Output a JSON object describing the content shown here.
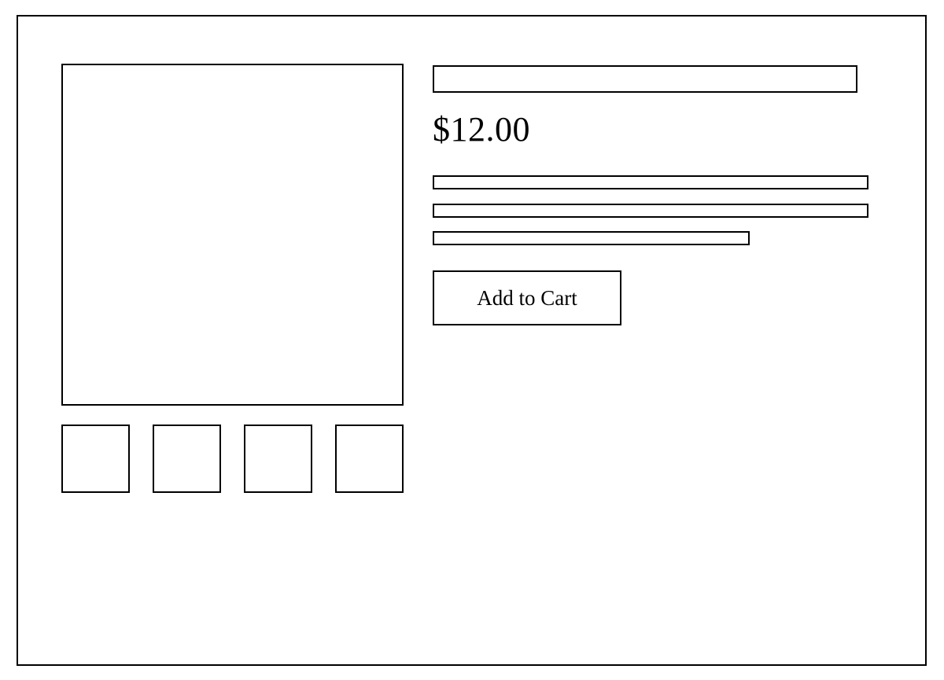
{
  "product": {
    "price": "$12.00",
    "add_to_cart_label": "Add to Cart"
  }
}
